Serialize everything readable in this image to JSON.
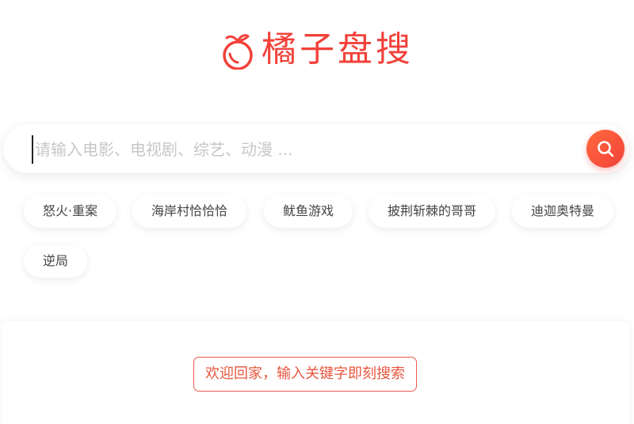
{
  "logo": {
    "text": "橘子盘搜",
    "icon": "orange-fruit-icon",
    "color": "#f2413a"
  },
  "search": {
    "placeholder": "请输入电影、电视剧、综艺、动漫 ...",
    "value": "",
    "button_icon": "search-icon",
    "accent": "#f2413a"
  },
  "hot_tags": [
    {
      "label": "怒火·重案"
    },
    {
      "label": "海岸村恰恰恰"
    },
    {
      "label": "鱿鱼游戏"
    },
    {
      "label": "披荆斩棘的哥哥"
    },
    {
      "label": "迪迦奥特曼"
    },
    {
      "label": "逆局"
    }
  ],
  "result": {
    "welcome": "欢迎回家，输入关键字即刻搜索"
  }
}
